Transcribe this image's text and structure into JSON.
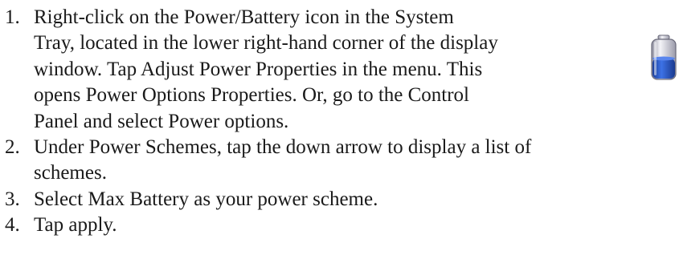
{
  "steps": [
    {
      "number": "1.",
      "text": "Right-click on the Power/Battery icon in the System\nTray, located in the lower right-hand corner of the display\nwindow. Tap Adjust Power Properties in the menu. This\nopens Power Options Properties. Or, go to the Control\nPanel and select Power options."
    },
    {
      "number": "2.",
      "text": "Under Power Schemes, tap the down arrow to display a list of\nschemes."
    },
    {
      "number": "3.",
      "text": "Select Max Battery as your power scheme."
    },
    {
      "number": "4.",
      "text": "Tap apply."
    }
  ],
  "battery_icon": {
    "icon": "battery-icon",
    "colors": {
      "body": "#dcdce6",
      "charge": "#2f5fd0",
      "outline": "#6a6a7a"
    }
  }
}
